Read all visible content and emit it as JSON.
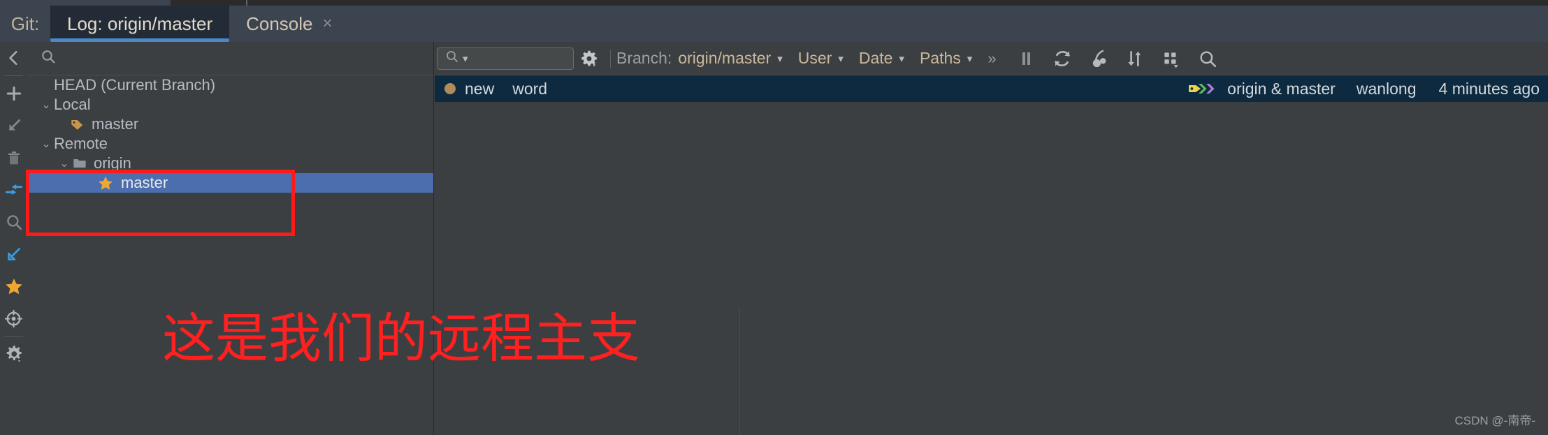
{
  "window": {
    "tool_label": "Git:",
    "tabs": [
      {
        "label": "Log: origin/master",
        "active": true,
        "closable": false
      },
      {
        "label": "Console",
        "active": false,
        "closable": true,
        "close_glyph": "×"
      }
    ]
  },
  "left_toolbar": {
    "items": [
      {
        "name": "collapse-back-icon",
        "glyph": "back-chevron"
      },
      {
        "name": "add-icon",
        "glyph": "plus"
      },
      {
        "name": "checkout-icon",
        "glyph": "arrow-down-left"
      },
      {
        "name": "delete-icon",
        "glyph": "trash"
      },
      {
        "name": "merge-icon",
        "glyph": "merge-arrows"
      },
      {
        "name": "search-icon",
        "glyph": "magnifier"
      },
      {
        "name": "rebase-icon",
        "glyph": "arrow-down-left-blue"
      },
      {
        "name": "favorite-icon",
        "glyph": "star"
      },
      {
        "name": "reset-icon",
        "glyph": "target"
      },
      {
        "name": "settings-icon",
        "glyph": "gear"
      }
    ]
  },
  "branches_panel": {
    "search_placeholder": "",
    "search_icon": "search-icon",
    "tree": [
      {
        "label": "HEAD (Current Branch)",
        "indent": 1,
        "expander": "",
        "icon": "none",
        "selected": false
      },
      {
        "label": "Local",
        "indent": 0,
        "expander": "⌄",
        "icon": "none",
        "selected": false
      },
      {
        "label": "master",
        "indent": 2,
        "expander": "",
        "icon": "tag-icon",
        "selected": false
      },
      {
        "label": "Remote",
        "indent": 0,
        "expander": "⌄",
        "icon": "none",
        "selected": false
      },
      {
        "label": "origin",
        "indent": 1,
        "expander": "⌄",
        "icon": "folder-icon",
        "selected": false
      },
      {
        "label": "master",
        "indent": 3,
        "expander": "",
        "icon": "star-icon",
        "selected": true
      }
    ]
  },
  "log_toolbar": {
    "search_value": "",
    "search_icon": "search-icon",
    "search_dropdown_caret": "▾",
    "settings_icon": "gear-icon",
    "filters": [
      {
        "key": "Branch:",
        "value": "origin/master",
        "caret": "▾"
      },
      {
        "key": "",
        "value": "User",
        "caret": "▾"
      },
      {
        "key": "",
        "value": "Date",
        "caret": "▾"
      },
      {
        "key": "",
        "value": "Paths",
        "caret": "▾"
      }
    ],
    "overflow_glyph": "»",
    "actions": [
      {
        "name": "pause-icon",
        "glyph": "pause"
      },
      {
        "name": "refresh-icon",
        "glyph": "refresh"
      },
      {
        "name": "cherry-pick-icon",
        "glyph": "cherry"
      },
      {
        "name": "sort-icon",
        "glyph": "sort-arrows"
      },
      {
        "name": "columns-icon",
        "glyph": "grid"
      },
      {
        "name": "search-icon",
        "glyph": "magnifier"
      }
    ]
  },
  "log_panel": {
    "commits": [
      {
        "node_color": "#b08d57",
        "subject": "new",
        "extra": "word",
        "refs": "origin & master",
        "author": "wanlong",
        "date": "4 minutes ago",
        "selected": true
      }
    ]
  },
  "annotations": {
    "note_text": "这是我们的远程主支",
    "note_color": "#ff2020",
    "highlight_box_color": "#ff1a1a",
    "watermark": "CSDN @-南帝-"
  }
}
